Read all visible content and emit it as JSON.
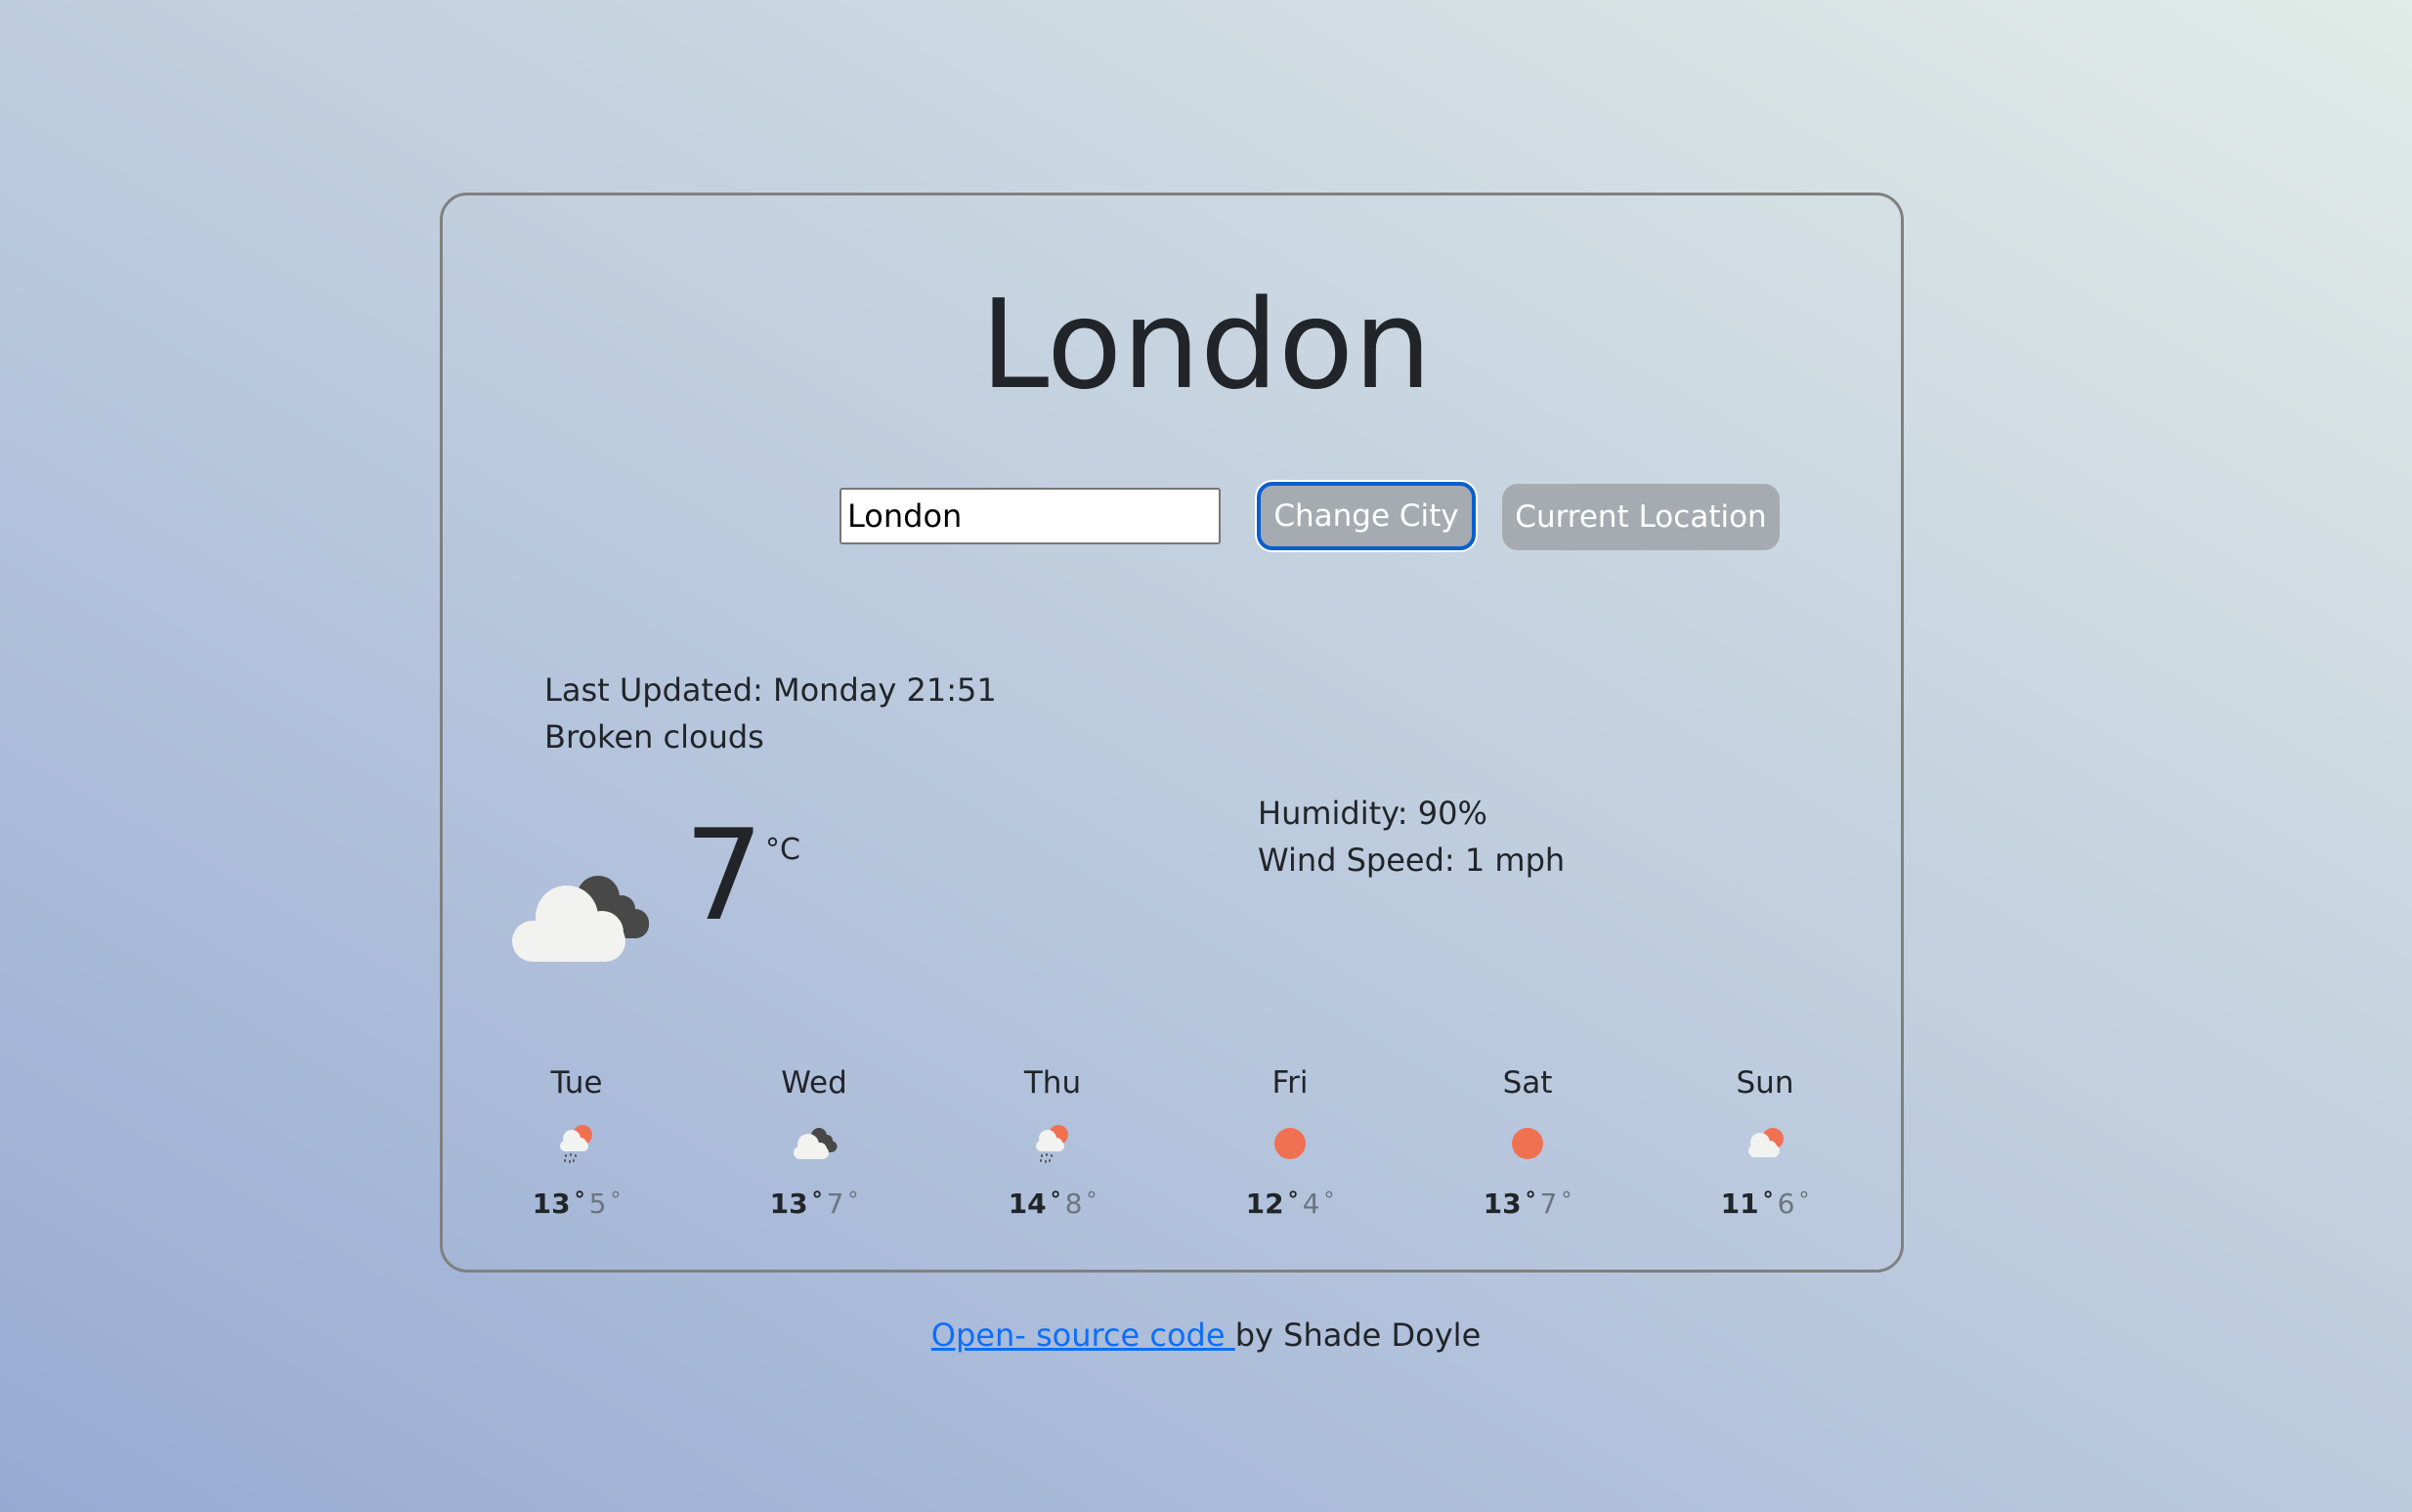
{
  "header": {
    "city_title": "London"
  },
  "search": {
    "input_value": "London",
    "change_city_label": "Change City",
    "current_location_label": "Current Location"
  },
  "current": {
    "last_updated": "Last Updated: Monday 21:51",
    "description": "Broken clouds",
    "icon": "broken-clouds-icon",
    "temperature": "7",
    "unit": "°C",
    "humidity": "Humidity: 90%",
    "wind_speed": "Wind Speed: 1 mph"
  },
  "forecast": [
    {
      "day": "Tue",
      "icon": "rain-sun-icon",
      "max": "13",
      "min": "5",
      "deg": "°"
    },
    {
      "day": "Wed",
      "icon": "broken-clouds-icon",
      "max": "13",
      "min": "7",
      "deg": "°"
    },
    {
      "day": "Thu",
      "icon": "rain-sun-icon",
      "max": "14",
      "min": "8",
      "deg": "°"
    },
    {
      "day": "Fri",
      "icon": "sun-icon",
      "max": "12",
      "min": "4",
      "deg": "°"
    },
    {
      "day": "Sat",
      "icon": "sun-icon",
      "max": "13",
      "min": "7",
      "deg": "°"
    },
    {
      "day": "Sun",
      "icon": "partly-cloudy-icon",
      "max": "11",
      "min": "6",
      "deg": "°"
    }
  ],
  "footer": {
    "link_text": "Open- source code ",
    "author_text": "by Shade Doyle"
  },
  "colors": {
    "sun": "#ef7152",
    "cloud_light": "#f2f2f0",
    "cloud_dark": "#484848",
    "button_grey": "#a6abb2",
    "focus_blue": "#0a5fce",
    "link_blue": "#0d6efd"
  }
}
